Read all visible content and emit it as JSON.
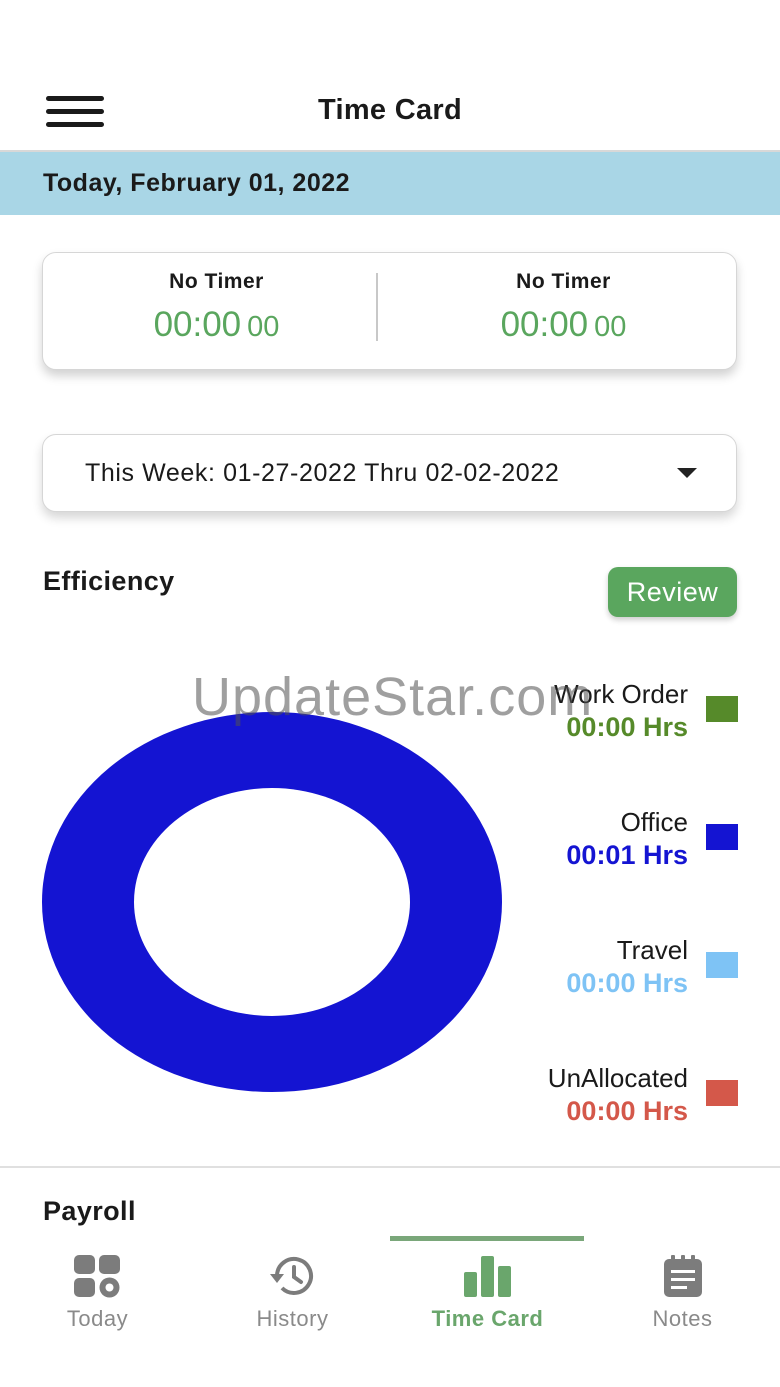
{
  "header": {
    "title": "Time Card",
    "menu_icon": "hamburger-menu-icon"
  },
  "date_bar": {
    "text": "Today, February 01, 2022"
  },
  "timers": [
    {
      "label": "No Timer",
      "time": "00:00",
      "seconds": "00"
    },
    {
      "label": "No Timer",
      "time": "00:00",
      "seconds": "00"
    }
  ],
  "week_selector": {
    "value": "This Week: 01-27-2022 Thru 02-02-2022",
    "icon": "caret-down-icon"
  },
  "efficiency": {
    "title": "Efficiency",
    "review_label": "Review"
  },
  "watermark": "UpdateStar.com",
  "chart_data": {
    "type": "pie",
    "donut": true,
    "categories": [
      "Work Order",
      "Office",
      "Travel",
      "UnAllocated"
    ],
    "values": [
      0,
      1,
      0,
      0
    ],
    "value_labels": [
      "00:00 Hrs",
      "00:01 Hrs",
      "00:00 Hrs",
      "00:00 Hrs"
    ],
    "colors": [
      "#568a2a",
      "#1414d2",
      "#7ec3f5",
      "#d4584a"
    ],
    "legend": "right"
  },
  "payroll": {
    "title": "Payroll"
  },
  "tabs": [
    {
      "label": "Today",
      "icon": "grid-apps-icon",
      "active": false
    },
    {
      "label": "History",
      "icon": "history-clock-icon",
      "active": false
    },
    {
      "label": "Time Card",
      "icon": "bar-chart-icon",
      "active": true
    },
    {
      "label": "Notes",
      "icon": "notepad-icon",
      "active": false
    }
  ]
}
